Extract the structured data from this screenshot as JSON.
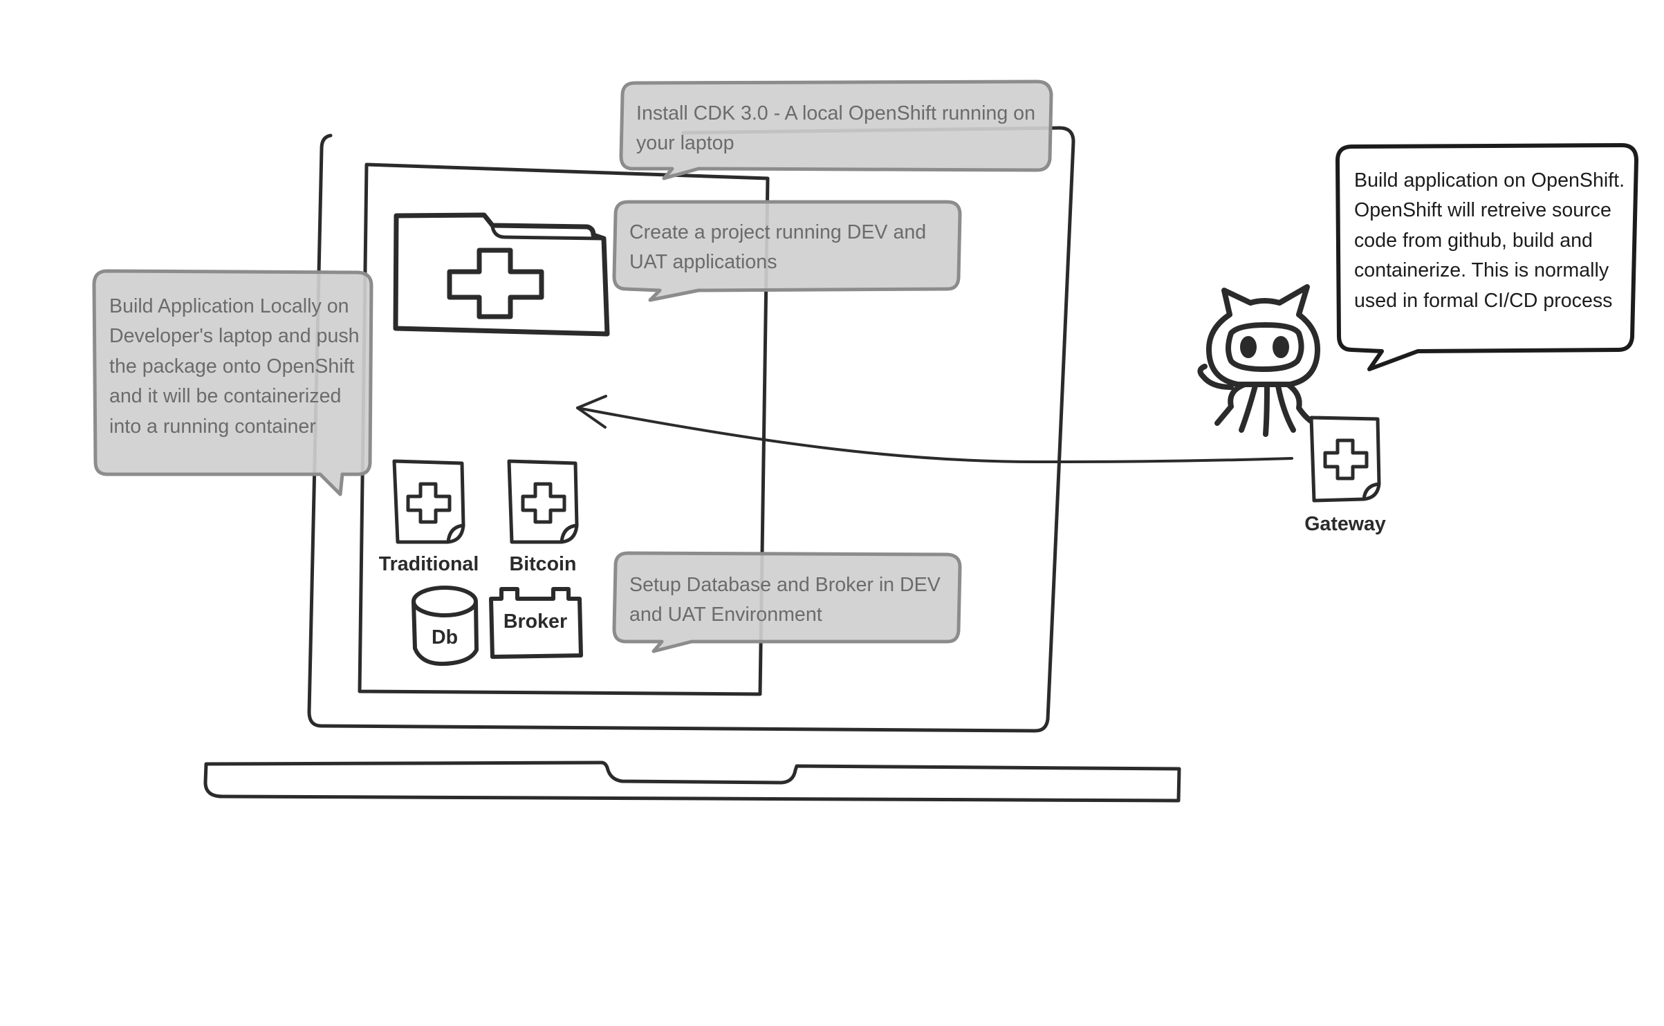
{
  "callouts": {
    "install_cdk": "Install CDK 3.0 - A local OpenShift running on your laptop",
    "create_project": "Create a project running DEV and UAT applications",
    "build_local": "Build Application Locally on Developer's laptop and push the package onto OpenShift and it will be containerized into a running container",
    "setup_db": "Setup Database and Broker in DEV and UAT Environment",
    "build_openshift": "Build application on OpenShift. OpenShift will retreive source code from github, build and containerize. This is normally used in formal CI/CD process"
  },
  "labels": {
    "traditional": "Traditional",
    "bitcoin": "Bitcoin",
    "db": "Db",
    "broker": "Broker",
    "gateway": "Gateway"
  },
  "colors": {
    "stroke": "#2b2b2b",
    "callout_fill": "#cfcfcf",
    "callout_stroke": "#8c8c8c",
    "callout_text": "#6b6b6b"
  },
  "icons": {
    "project_folder": "folder-plus-icon",
    "app_document": "document-plus-icon",
    "database": "database-icon",
    "broker": "battery-broker-icon",
    "source_repo": "github-octocat-icon"
  }
}
